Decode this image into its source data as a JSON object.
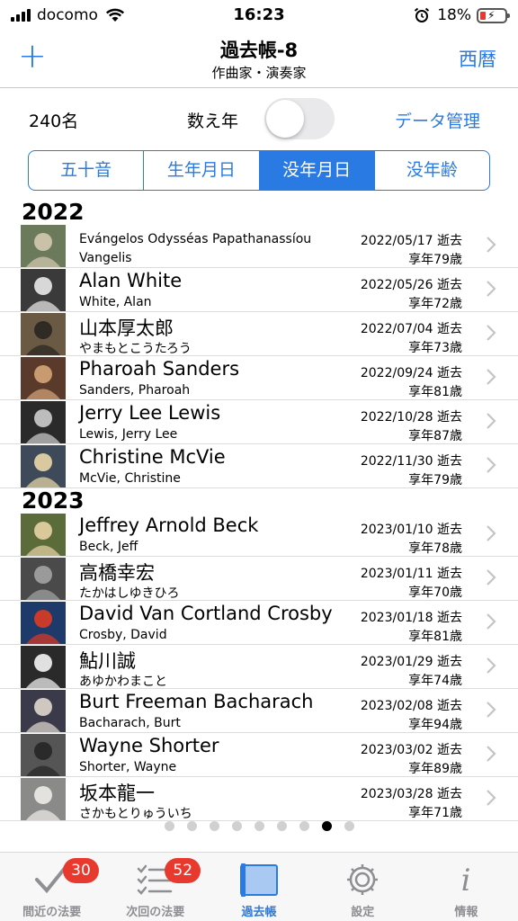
{
  "status": {
    "carrier": "docomo",
    "time": "16:23",
    "battery": "18%"
  },
  "nav": {
    "title": "過去帳-8",
    "subtitle": "作曲家・演奏家",
    "plus": "+",
    "era_button": "西暦"
  },
  "controls": {
    "count": "240名",
    "kazoe_label": "数え年",
    "kazoe_on": false,
    "data_button": "データ管理"
  },
  "segments": [
    "五十音",
    "生年月日",
    "没年月日",
    "没年齢"
  ],
  "active_segment": 2,
  "sections": [
    {
      "year": "2022",
      "rows": [
        {
          "name": "Evángelos Odysséas Papathanassíou",
          "sub": "Vangelis",
          "date": "2022/05/17 逝去",
          "age": "享年79歳"
        },
        {
          "name": "Alan White",
          "sub": "White, Alan",
          "date": "2022/05/26 逝去",
          "age": "享年72歳"
        },
        {
          "name": "山本厚太郎",
          "sub": "やまもとこうたろう",
          "date": "2022/07/04 逝去",
          "age": "享年73歳"
        },
        {
          "name": "Pharoah Sanders",
          "sub": "Sanders, Pharoah",
          "date": "2022/09/24 逝去",
          "age": "享年81歳"
        },
        {
          "name": "Jerry Lee Lewis",
          "sub": "Lewis, Jerry Lee",
          "date": "2022/10/28 逝去",
          "age": "享年87歳"
        },
        {
          "name": "Christine McVie",
          "sub": "McVie, Christine",
          "date": "2022/11/30 逝去",
          "age": "享年79歳"
        }
      ]
    },
    {
      "year": "2023",
      "rows": [
        {
          "name": "Jeffrey Arnold Beck",
          "sub": "Beck, Jeff",
          "date": "2023/01/10 逝去",
          "age": "享年78歳"
        },
        {
          "name": "高橋幸宏",
          "sub": "たかはしゆきひろ",
          "date": "2023/01/11 逝去",
          "age": "享年70歳"
        },
        {
          "name": "David Van Cortland Crosby",
          "sub": "Crosby, David",
          "date": "2023/01/18 逝去",
          "age": "享年81歳"
        },
        {
          "name": "鮎川誠",
          "sub": "あゆかわまこと",
          "date": "2023/01/29 逝去",
          "age": "享年74歳"
        },
        {
          "name": "Burt Freeman Bacharach",
          "sub": "Bacharach, Burt",
          "date": "2023/02/08 逝去",
          "age": "享年94歳"
        },
        {
          "name": "Wayne Shorter",
          "sub": "Shorter, Wayne",
          "date": "2023/03/02 逝去",
          "age": "享年89歳"
        },
        {
          "name": "坂本龍一",
          "sub": "さかもとりゅういち",
          "date": "2023/03/28 逝去",
          "age": "享年71歳"
        }
      ]
    }
  ],
  "page_dots": {
    "count": 9,
    "active": 7
  },
  "tabs": [
    {
      "label": "間近の法要",
      "badge": "30",
      "icon": "check-icon"
    },
    {
      "label": "次回の法要",
      "badge": "52",
      "icon": "checklist-icon"
    },
    {
      "label": "過去帳",
      "badge": "",
      "icon": "book-icon"
    },
    {
      "label": "設定",
      "badge": "",
      "icon": "gear-icon"
    },
    {
      "label": "情報",
      "badge": "",
      "icon": "info-icon"
    }
  ],
  "active_tab": 2,
  "colors": {
    "accent": "#2a7ae4",
    "badge": "#e8392f"
  }
}
